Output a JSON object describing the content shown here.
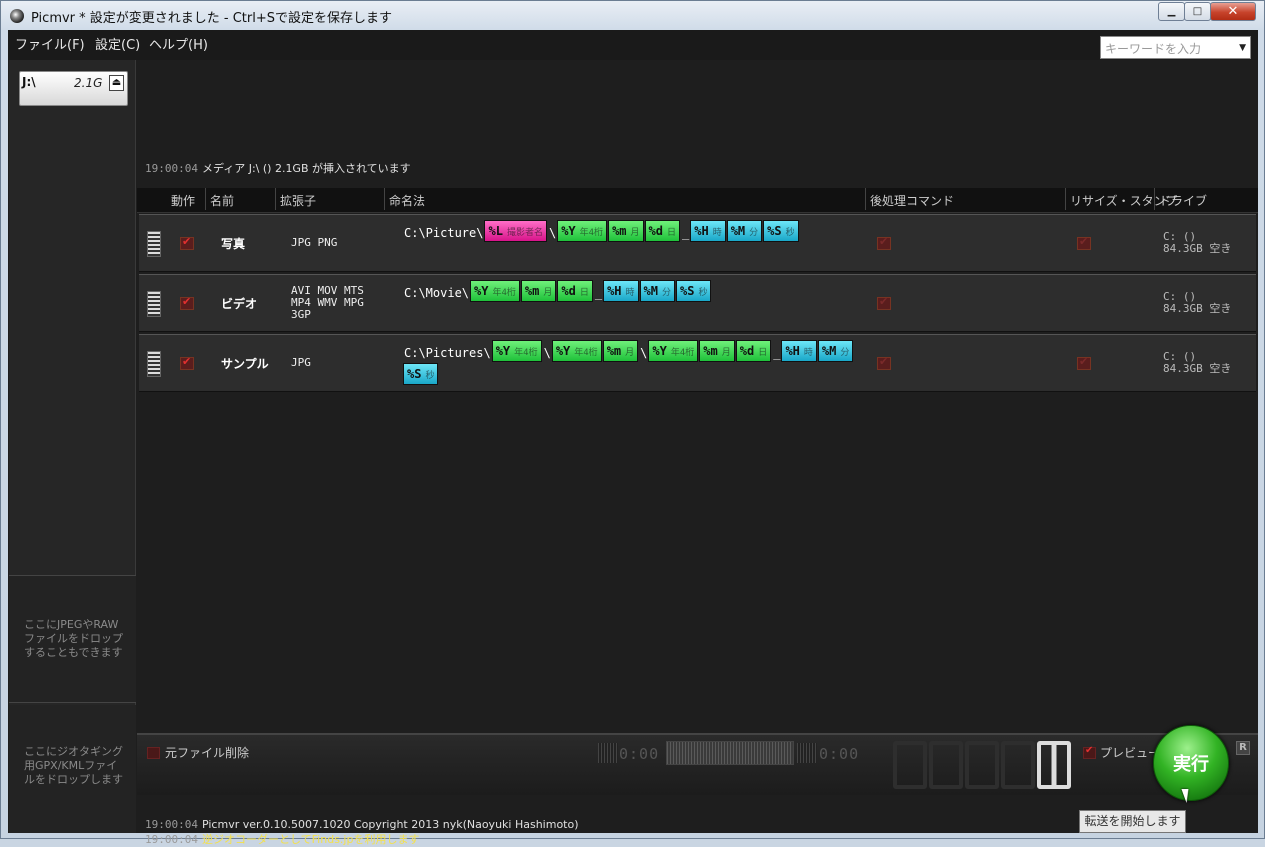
{
  "window": {
    "title": "Picmvr * 設定が変更されました - Ctrl+Sで設定を保存します"
  },
  "menu": [
    {
      "label": "ファイル(F)"
    },
    {
      "label": "設定(C)"
    },
    {
      "label": "ヘルプ(H)"
    }
  ],
  "search": {
    "placeholder": "キーワードを入力"
  },
  "media": {
    "label": "J:\\",
    "size": "2.1G"
  },
  "left_drop": {
    "images_text": "ここにJPEGやRAWファイルをドロップすることもできます",
    "geotag_text": "ここにジオタギング用GPX/KMLファイルをドロップします"
  },
  "log_top": {
    "time": "19:00:04",
    "text": "メディア J:\\ () 2.1GB が挿入されています"
  },
  "table": {
    "headers": {
      "action": "動作",
      "name": "名前",
      "ext": "拡張子",
      "naming": "命名法",
      "post": "後処理コマンド",
      "resize": "リサイズ・スタンプ",
      "drive": "ドライブ"
    },
    "rows": [
      {
        "name": "写真",
        "ext_lines": [
          "JPG PNG"
        ],
        "prefix": "C:\\Picture\\",
        "drive_line1": "C: ()",
        "drive_line2": "84.3GB 空き"
      },
      {
        "name": "ビデオ",
        "ext_lines": [
          "AVI MOV MTS",
          "MP4 WMV MPG",
          "3GP"
        ],
        "prefix": "C:\\Movie\\",
        "drive_line1": "C: ()",
        "drive_line2": "84.3GB 空き"
      },
      {
        "name": "サンプル",
        "ext_lines": [
          "JPG"
        ],
        "prefix": "C:\\Pictures\\",
        "drive_line1": "C: ()",
        "drive_line2": "84.3GB 空き"
      }
    ],
    "tokens": {
      "L": {
        "code": "%L",
        "sub": "撮影者名"
      },
      "Y": {
        "code": "%Y",
        "sub": "年4桁"
      },
      "m": {
        "code": "%m",
        "sub": "月"
      },
      "d": {
        "code": "%d",
        "sub": "日"
      },
      "H": {
        "code": "%H",
        "sub": "時"
      },
      "M": {
        "code": "%M",
        "sub": "分"
      },
      "S": {
        "code": "%S",
        "sub": "秒"
      }
    },
    "sep_backslash": "\\",
    "sep_underscore": "_"
  },
  "bottom": {
    "delete_label": "元ファイル削除",
    "time_left": "0:00",
    "time_right": "0:00",
    "preview_label": "プレビュー",
    "run_label": "実行",
    "r_label": "R",
    "tooltip": "転送を開始します"
  },
  "log_bottom": [
    {
      "time": "19:00:04",
      "text": "Picmvr ver.0.10.5007.1020 Copyright 2013 nyk(Naoyuki Hashimoto)"
    },
    {
      "time": "19:00:04",
      "text": "逆ジオコーダーとしてFinds.jpを利用します"
    }
  ],
  "colors": {
    "green_token": "#22c33c",
    "cyan_token": "#1aa7c8",
    "magenta_token": "#d8148a",
    "run_button": "#32b324",
    "log_highlight": "#f4e14c"
  }
}
